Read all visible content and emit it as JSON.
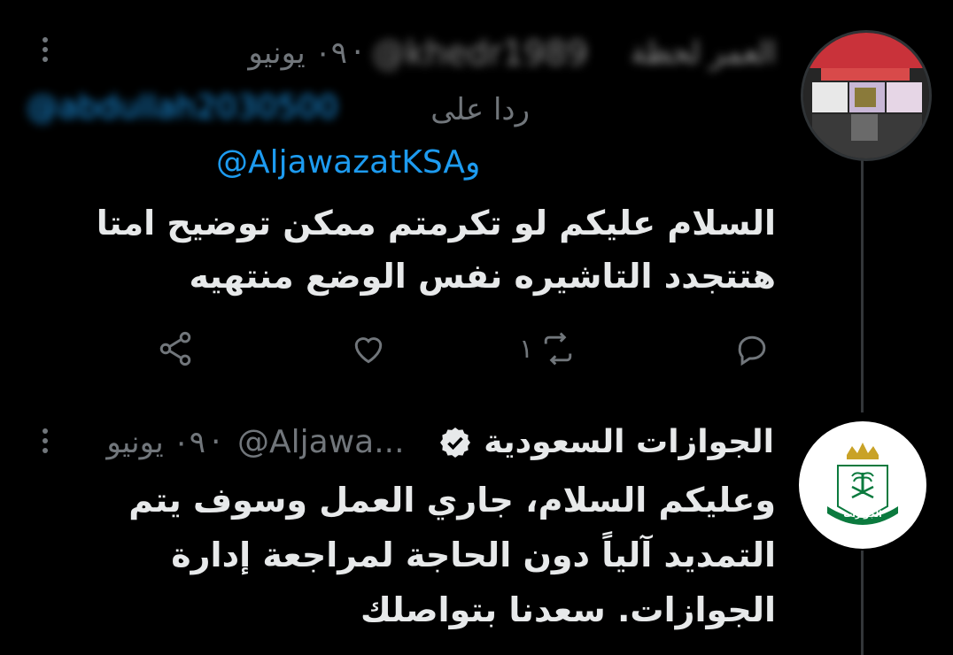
{
  "tweet1": {
    "date": "٠٩ يونيو",
    "separator": "·",
    "handle_blurred": "@khedr1989",
    "name_blurred": "العمر لحظة",
    "replying_to_label": "ردا على",
    "replying_to_blurred": "@abdullah2030500",
    "mention": "@AljawazatKSA",
    "mention_prefix": "و",
    "text": "السلام عليكم لو تكرمتم ممكن توضيح امتا هتتجدد التاشيره نفس الوضع منتهيه",
    "retweet_count": "١",
    "icons": {
      "share": "share-icon",
      "like": "heart-icon",
      "retweet": "retweet-icon",
      "reply": "reply-icon",
      "more": "more-icon"
    }
  },
  "tweet2": {
    "name": "الجوازات السعودية",
    "handle": "@Aljawa...",
    "date": "٠٩ يونيو",
    "separator": "·",
    "text": "وعليكم السلام، جاري العمل وسوف يتم التمديد آلياً دون الحاجة لمراجعة إدارة الجوازات. سعدنا بتواصلك",
    "logo_text": "الجوازات"
  },
  "colors": {
    "background": "#000000",
    "text": "#e7e9ea",
    "muted": "#71767b",
    "link": "#1d9bf0",
    "thread_line": "#333639",
    "logo_green": "#0b7a3e",
    "logo_gold": "#c9a227"
  }
}
